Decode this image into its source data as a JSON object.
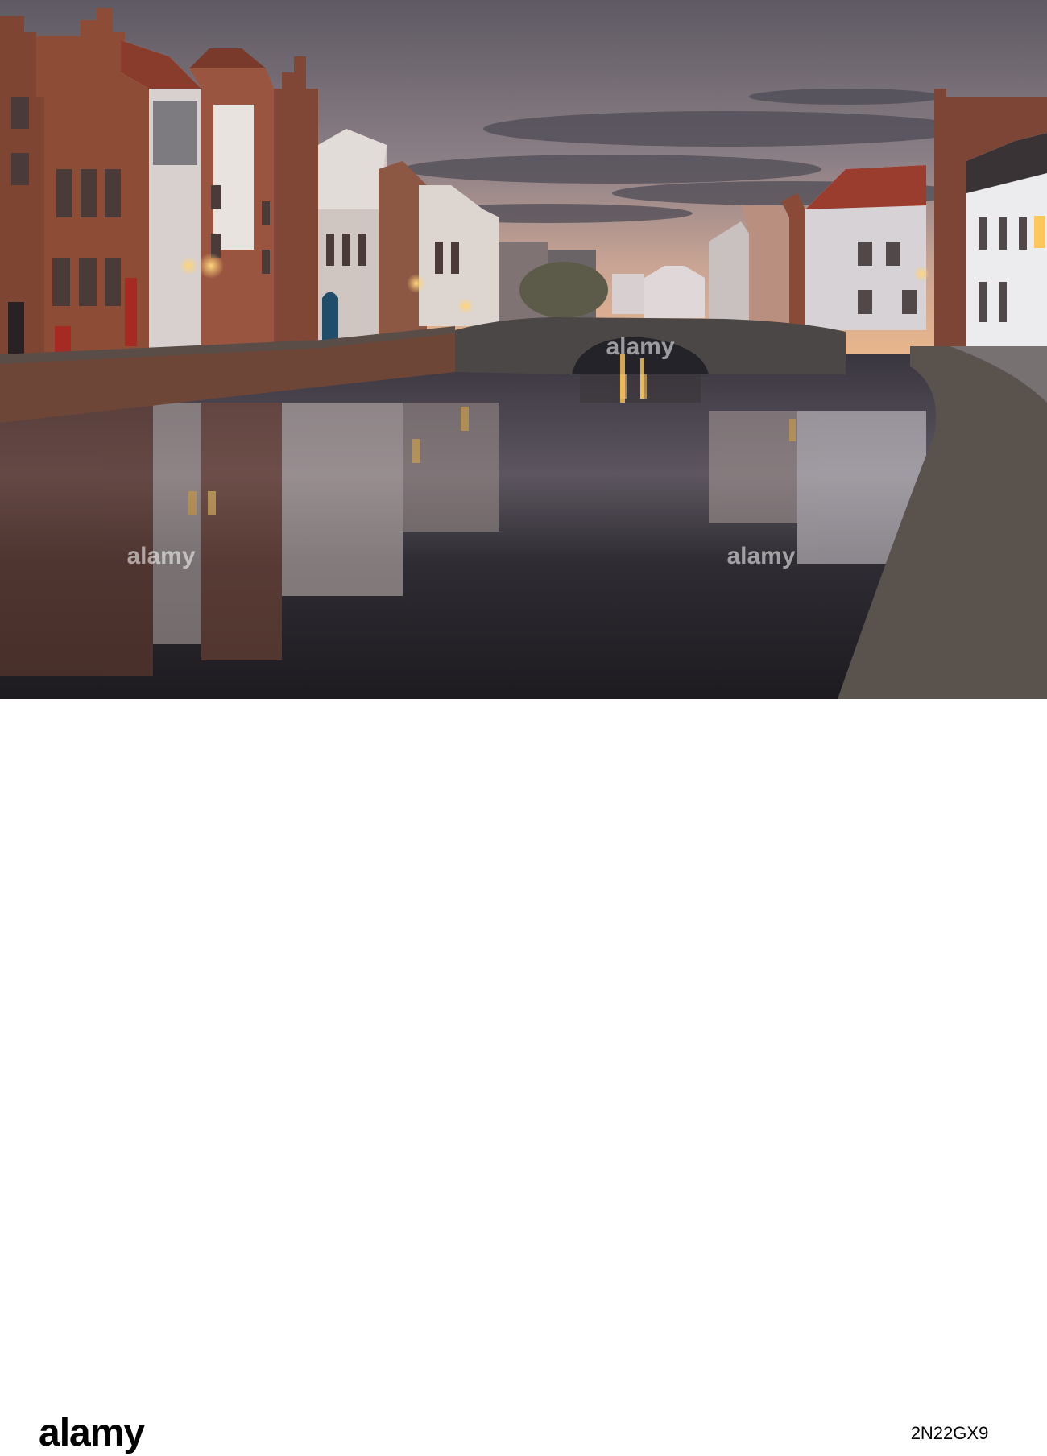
{
  "photo": {
    "subject": "canal-scene-at-dusk",
    "colors": {
      "sky_top": "#6e6770",
      "sky_glow": "#e6b590",
      "water": "#2a2a30",
      "brick": "#8a4c36",
      "lamp": "#ffc75a"
    }
  },
  "watermark": {
    "text": "alamy"
  },
  "footer": {
    "logo_text": "alamy",
    "image_id": "2N22GX9"
  }
}
